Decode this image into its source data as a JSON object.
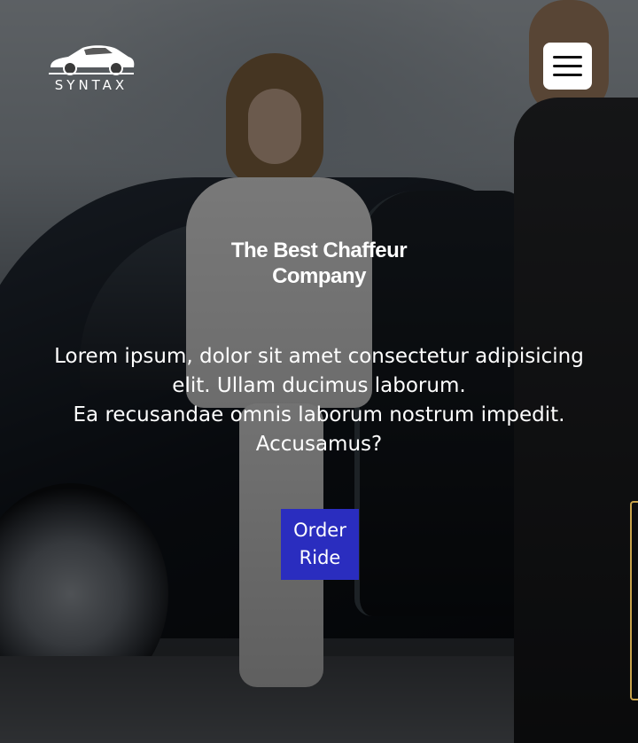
{
  "brand": {
    "logo_text": "SYNTAX",
    "logo_icon": "sports-car-icon"
  },
  "nav": {
    "menu_icon": "hamburger-menu-icon"
  },
  "hero": {
    "title": "The Best Chaffeur Company",
    "description_lines": [
      "Lorem ipsum, dolor sit amet consectetur adipisicing elit. Ullam ducimus laborum.",
      "Ea recusandae omnis laborum nostrum impedit. Accusamus?"
    ],
    "cta_label": "Order Ride"
  },
  "colors": {
    "cta_background": "#2a2dbf",
    "overlay": "rgba(0,0,0,0.5)",
    "menu_button_background": "#ffffff"
  }
}
